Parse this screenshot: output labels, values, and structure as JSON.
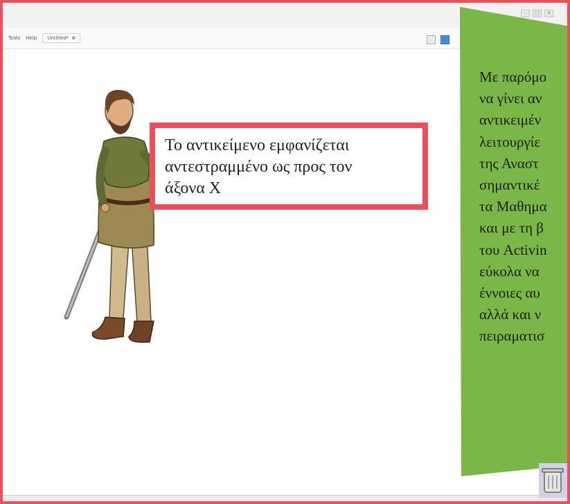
{
  "menu": {
    "tools": "Tools",
    "help": "Help"
  },
  "document_tab": {
    "name": "Untitled*",
    "close": "⊗"
  },
  "callout": {
    "text_lines": [
      "Το αντικείμενο εμφανίζεται",
      "αντεστραμμένο ως προς τον",
      "άξονα Χ"
    ]
  },
  "side_note": {
    "lines": [
      "Με παρόμο",
      "να γίνει αν",
      "αντικειμέν",
      "λειτουργίε",
      "της Αναστ",
      "σημαντικέ",
      "τα Μαθημα",
      "και με τη β",
      "του Activin",
      "εύκολα να",
      "έννοιες αυ",
      "αλλά και ν",
      "πειραματισ"
    ],
    "color": "#7ab648"
  },
  "accent_color": "#e8515c",
  "icons": [
    "window-controls",
    "toolbar-icon",
    "trash-icon",
    "medieval-figure"
  ]
}
